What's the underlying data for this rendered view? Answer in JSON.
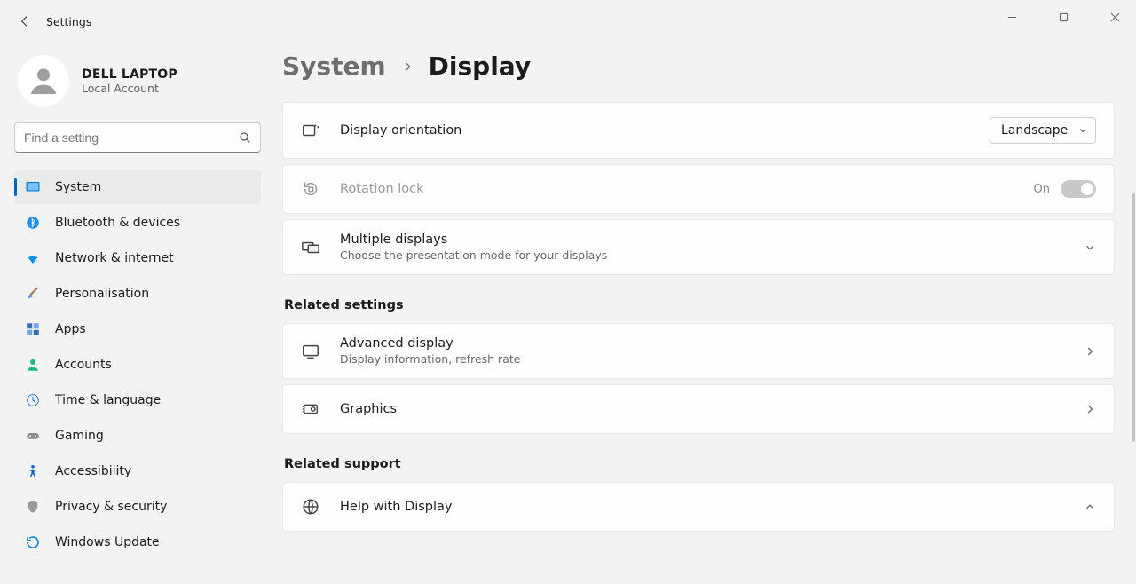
{
  "window": {
    "title": "Settings"
  },
  "account": {
    "name": "DELL LAPTOP",
    "sub": "Local Account"
  },
  "search": {
    "placeholder": "Find a setting"
  },
  "sidebar": {
    "items": [
      {
        "label": "System"
      },
      {
        "label": "Bluetooth & devices"
      },
      {
        "label": "Network & internet"
      },
      {
        "label": "Personalisation"
      },
      {
        "label": "Apps"
      },
      {
        "label": "Accounts"
      },
      {
        "label": "Time & language"
      },
      {
        "label": "Gaming"
      },
      {
        "label": "Accessibility"
      },
      {
        "label": "Privacy & security"
      },
      {
        "label": "Windows Update"
      }
    ]
  },
  "breadcrumb": {
    "parent": "System",
    "current": "Display"
  },
  "cards": {
    "orientation": {
      "title": "Display orientation",
      "value": "Landscape"
    },
    "rotation": {
      "title": "Rotation lock",
      "state": "On"
    },
    "multi": {
      "title": "Multiple displays",
      "sub": "Choose the presentation mode for your displays"
    }
  },
  "related_settings_header": "Related settings",
  "related": {
    "advanced": {
      "title": "Advanced display",
      "sub": "Display information, refresh rate"
    },
    "graphics": {
      "title": "Graphics"
    }
  },
  "related_support_header": "Related support",
  "support": {
    "help": {
      "title": "Help with Display"
    }
  }
}
